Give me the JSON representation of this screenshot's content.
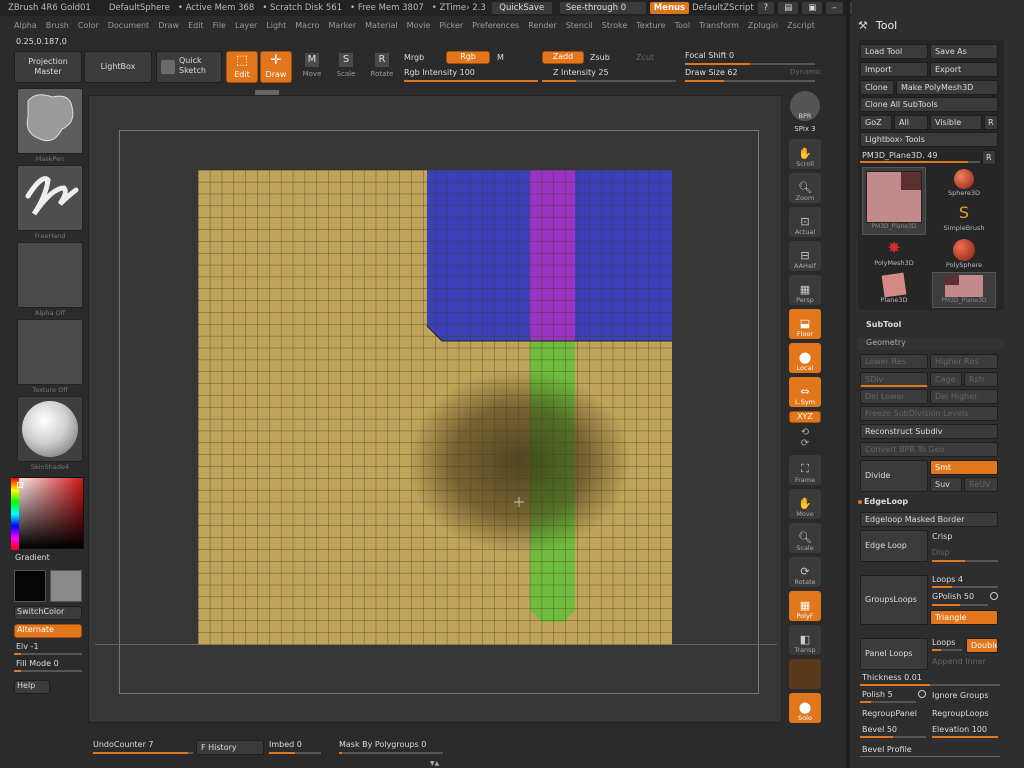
{
  "titlebar": {
    "app": "ZBrush 4R6 Gold01",
    "document": "DefaultSphere",
    "active_mem": "• Active Mem 368",
    "scratch": "• Scratch Disk 561",
    "free_mem": "• Free Mem 3807",
    "ztime": "• ZTime› 2.3",
    "quicksave": "QuickSave",
    "seethrough": "See-through",
    "seethrough_val": "0",
    "menus": "Menus",
    "zscript": "DefaultZScript"
  },
  "menubar": [
    "Alpha",
    "Brush",
    "Color",
    "Document",
    "Draw",
    "Edit",
    "File",
    "Layer",
    "Light",
    "Macro",
    "Marker",
    "Material",
    "Movie",
    "Picker",
    "Preferences",
    "Render",
    "Stencil",
    "Stroke",
    "Texture",
    "Tool",
    "Transform",
    "Zplugin",
    "Zscript"
  ],
  "coords": "0.25,0.187,0",
  "toolbar": {
    "projection_master": "Projection Master",
    "lightbox": "LightBox",
    "quick_sketch": "Quick Sketch",
    "edit": "Edit",
    "draw": "Draw",
    "move": "Move",
    "scale": "Scale",
    "rotate": "Rotate",
    "mrgb": "Mrgb",
    "rgb": "Rgb",
    "m": "M",
    "rgb_intensity": "Rgb Intensity 100",
    "zadd": "Zadd",
    "zsub": "Zsub",
    "zcut": "Zcut",
    "z_intensity": "Z Intensity 25",
    "focal_shift": "Focal Shift 0",
    "draw_size": "Draw Size 62",
    "dynamic": "Dynamic"
  },
  "left": {
    "maskpen": "MaskPen",
    "freehand": "FreeHand",
    "alpha_off": "Alpha Off",
    "texture_off": "Texture Off",
    "skinshade": "SkinShade4",
    "gradient": "Gradient",
    "switchcolor": "SwitchColor",
    "alternate": "Alternate",
    "elv": "Elv -1",
    "fill_mode": "Fill Mode 0",
    "help": "Help"
  },
  "rightstrip": [
    "BPR",
    "SPix 3",
    "Scroll",
    "Zoom",
    "Actual",
    "AAHalf",
    "Persp",
    "Floor",
    "Local",
    "L.Sym",
    "XYZ",
    "Frame",
    "Move",
    "Scale",
    "Rotate",
    "PolyF",
    "Transp",
    "Solo"
  ],
  "toolpanel": {
    "title": "Tool",
    "load_tool": "Load Tool",
    "save_as": "Save As",
    "import": "Import",
    "export": "Export",
    "clone": "Clone",
    "make_polymesh": "Make PolyMesh3D",
    "clone_all": "Clone All SubTools",
    "goz": "GoZ",
    "all": "All",
    "visible": "Visible",
    "r": "R",
    "lightbox_tools": "Lightbox› Tools",
    "current_tool": "PM3D_Plane3D. 49",
    "tools": [
      "PM3D_Plane3D",
      "Sphere3D",
      "SimpleBrush",
      "PolyMesh3D",
      "PolySphere",
      "Plane3D",
      "PM3D_Plane3D"
    ],
    "subtool": "SubTool",
    "geometry": "Geometry",
    "lower_res": "Lower Res",
    "higher_res": "Higher Res",
    "sdiv": "SDiv",
    "cage": "Cage",
    "rstr": "Rstr",
    "del_lower": "Del Lower",
    "del_higher": "Del Higher",
    "freeze": "Freeze SubDivision Levels",
    "reconstruct": "Reconstruct Subdiv",
    "convert_bpr": "Convert BPR To Geo",
    "divide": "Divide",
    "smt": "Smt",
    "suv": "Suv",
    "reuv": "ReUV",
    "edgeloop": "EdgeLoop",
    "edgeloop_masked": "Edgeloop Masked Border",
    "edge_loop": "Edge Loop",
    "crisp": "Crisp",
    "disp": "Disp",
    "groupsloops": "GroupsLoops",
    "loops4": "Loops 4",
    "gpolish": "GPolish 50",
    "triangle": "Triangle",
    "panel_loops": "Panel Loops",
    "loops": "Loops",
    "double": "Double",
    "append_inner": "Append Inner",
    "thickness": "Thickness 0.01",
    "polish": "Polish 5",
    "ignore_groups": "Ignore Groups",
    "regroup_panel": "RegroupPanel",
    "regroup_loops": "RegroupLoops",
    "bevel": "Bevel 50",
    "elevation": "Elevation 100",
    "bevel_profile": "Bevel Profile"
  },
  "bottom": {
    "undo": "UndoCounter 7",
    "history": "F History",
    "imbed": "Imbed 0",
    "mask_by_poly": "Mask By Polygroups 0"
  },
  "colors": {
    "accent": "#e2761d",
    "mesh_tan": "#bfa45a",
    "mesh_blue": "#3b40b8",
    "mesh_purple": "#9b34c2",
    "mesh_green": "#6fbc3f"
  }
}
